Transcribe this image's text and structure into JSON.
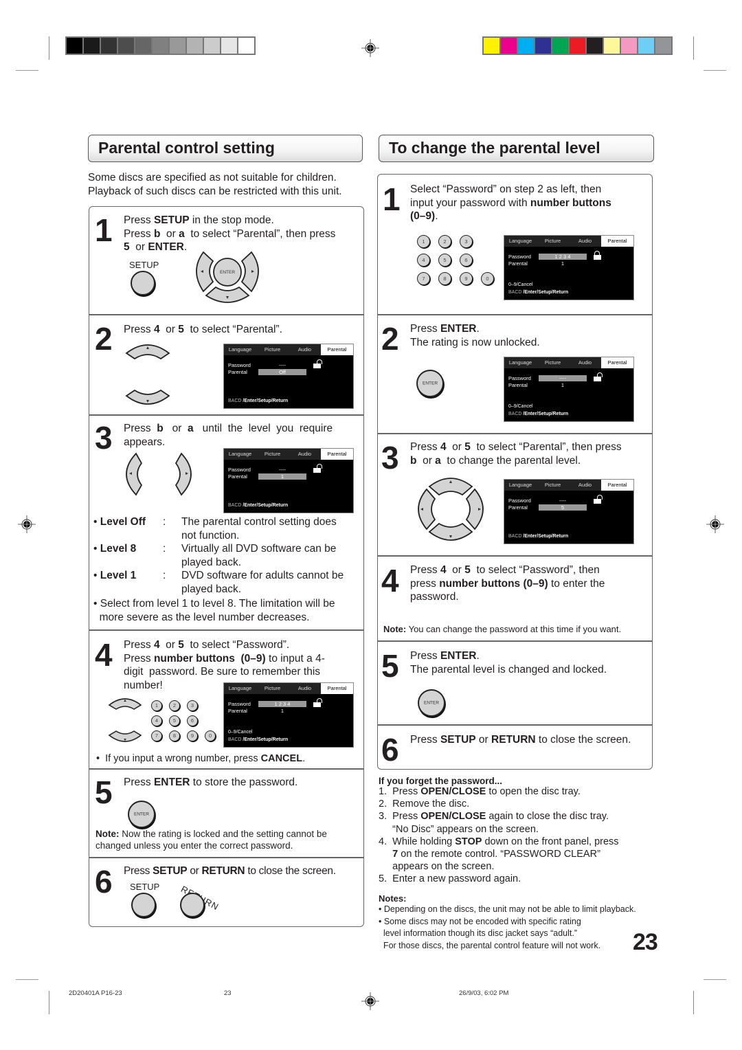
{
  "print_marks": {
    "grayscale_swatches": [
      "#000000",
      "#1a1a1a",
      "#333333",
      "#4d4d4d",
      "#666666",
      "#808080",
      "#999999",
      "#b3b3b3",
      "#cccccc",
      "#e6e6e6",
      "#ffffff"
    ],
    "color_swatches": [
      "#fff200",
      "#ec008c",
      "#00aeef",
      "#2e3192",
      "#00a651",
      "#ed1c24",
      "#231f20",
      "#fff799",
      "#f49ac1",
      "#6dcff6",
      "#939598"
    ]
  },
  "left": {
    "title": "Parental control setting",
    "intro": [
      "Some discs are specified as not suitable for children.",
      "Playback of such discs can be restricted with this unit."
    ],
    "steps": [
      {
        "num": "1",
        "lines": [
          "Press <b>SETUP</b> in the stop mode.",
          "Press <b>b</b> &nbsp;or <b>a</b> &nbsp;to select “Parental”, then press",
          "<b>5</b> &nbsp;or <b>ENTER</b>."
        ],
        "setup_label": "SETUP",
        "enter_label": "ENTER"
      },
      {
        "num": "2",
        "lines": [
          "Press <b>4</b> &nbsp;or <b>5</b> &nbsp;to select “Parental”."
        ]
      },
      {
        "num": "3",
        "lines": [
          "Press &nbsp;<b>b</b> &nbsp;&nbsp;or &nbsp;<b>a</b> &nbsp;&nbsp;until &nbsp;the &nbsp;level &nbsp;you &nbsp;require",
          "appears."
        ]
      },
      {
        "num": "4",
        "lines": [
          "Press <b>4</b> &nbsp;or <b>5</b> &nbsp;to select “Password”.",
          "Press <b>number buttons &nbsp;(0–9)</b> to input a 4-",
          "digit &nbsp;password. Be sure to remember this",
          "number!"
        ],
        "note": "If you input a wrong number, press <b>CANCEL</b>."
      },
      {
        "num": "5",
        "lines": [
          "Press <b>ENTER</b> to store the password."
        ],
        "enter_label": "ENTER",
        "note": "<b>Note:</b> Now the rating is locked and the setting cannot be changed unless you enter the correct password."
      },
      {
        "num": "6",
        "lines": [
          "Press <b>SETUP</b> or <b>RETURN</b> to close the screen."
        ],
        "setup_label": "SETUP",
        "return_label": "RETURN"
      }
    ],
    "levels": [
      {
        "name": "Level Off",
        "desc": [
          "The parental control setting does",
          "not function."
        ]
      },
      {
        "name": "Level 8",
        "desc": [
          "Virtually all DVD software can be",
          "played back."
        ]
      },
      {
        "name": "Level 1",
        "desc": [
          "DVD software for adults cannot be",
          "played back."
        ]
      }
    ],
    "level_note": [
      "Select from level 1 to level 8. The limitation will be",
      "more severe as the level number decreases."
    ]
  },
  "right": {
    "title": "To change the parental level",
    "steps": [
      {
        "num": "1",
        "lines": [
          "Select “Password” on step 2 as left, then",
          "input your password with <b>number buttons</b>",
          "<b>(0–9)</b>."
        ]
      },
      {
        "num": "2",
        "lines": [
          "Press <b>ENTER</b>.",
          "The rating is now unlocked."
        ],
        "enter_label": "ENTER"
      },
      {
        "num": "3",
        "lines": [
          "Press <b>4</b> &nbsp;or <b>5</b> &nbsp;to select “Parental”, then press",
          "<b>b</b> &nbsp;or <b>a</b> &nbsp;to change the parental level."
        ]
      },
      {
        "num": "4",
        "lines": [
          "Press <b>4</b> &nbsp;or <b>5</b> &nbsp;to select “Password”, then",
          "press <b>number buttons (0–9)</b> to enter the",
          "password."
        ],
        "note": "<b>Note:</b> You can change the password at this time if you want."
      },
      {
        "num": "5",
        "lines": [
          "Press <b>ENTER</b>.",
          "The parental level is changed and locked."
        ],
        "enter_label": "ENTER"
      },
      {
        "num": "6",
        "lines": [
          "Press <b>SETUP</b> or <b>RETURN</b> to close the screen."
        ]
      }
    ],
    "forget": {
      "title": "If you forget the password...",
      "items": [
        "1. &nbsp;Press <b>OPEN/CLOSE</b> to open the disc tray.",
        "2. &nbsp;Remove the disc.",
        "3. &nbsp;Press <b>OPEN/CLOSE</b> again to close the disc tray.",
        "&nbsp;&nbsp;&nbsp;&nbsp;&nbsp;“No Disc” appears on the screen.",
        "4. &nbsp;While holding <b>STOP</b> down on the front panel, press",
        "&nbsp;&nbsp;&nbsp;&nbsp;&nbsp;<b>7</b> on the remote control. “PASSWORD CLEAR”",
        "&nbsp;&nbsp;&nbsp;&nbsp;&nbsp;appears on the screen.",
        "5. &nbsp;Enter a new password again."
      ]
    },
    "notes": {
      "title": "Notes:",
      "items": [
        "• Depending on the discs, the unit may not be able to limit playback.",
        "• Some discs may not be encoded with specific rating",
        "&nbsp;&nbsp;level information though its disc jacket says “adult.”",
        "&nbsp;&nbsp;For those discs, the parental control feature will not work."
      ]
    }
  },
  "osd": {
    "tabs": [
      "Language",
      "Picture",
      "Audio",
      "Parental"
    ],
    "active_tab": "Parental",
    "password_label": "Password",
    "parental_label": "Parental",
    "footer_keys": "0–9/Cancel",
    "footer_nav_prefix": "BACD ",
    "footer_nav": "/Enter/Setup/Return",
    "screens": {
      "left2": {
        "password": "----",
        "parental": "Off",
        "highlight": "parental",
        "lock": "open",
        "show_keys": false
      },
      "left3": {
        "password": "----",
        "parental": "1",
        "highlight": "parental",
        "lock": "open",
        "show_keys": false
      },
      "left4": {
        "password": "1 2 3 4",
        "parental": "1",
        "highlight": "password",
        "lock": "open",
        "show_keys": true
      },
      "right1": {
        "password": "1 2 3 4",
        "parental": "1",
        "highlight": "password",
        "lock": "closed",
        "show_keys": true
      },
      "right2": {
        "password": "----",
        "parental": "1",
        "highlight": "password",
        "lock": "open",
        "show_keys": true
      },
      "right3": {
        "password": "----",
        "parental": "5",
        "highlight": "parental",
        "lock": "open",
        "show_keys": false
      }
    }
  },
  "number_buttons": [
    "1",
    "2",
    "3",
    "4",
    "5",
    "6",
    "7",
    "8",
    "9",
    "0"
  ],
  "page_number": "23",
  "footer": {
    "code": "2D20401A P16-23",
    "page": "23",
    "timestamp": "26/9/03, 6:02 PM"
  }
}
